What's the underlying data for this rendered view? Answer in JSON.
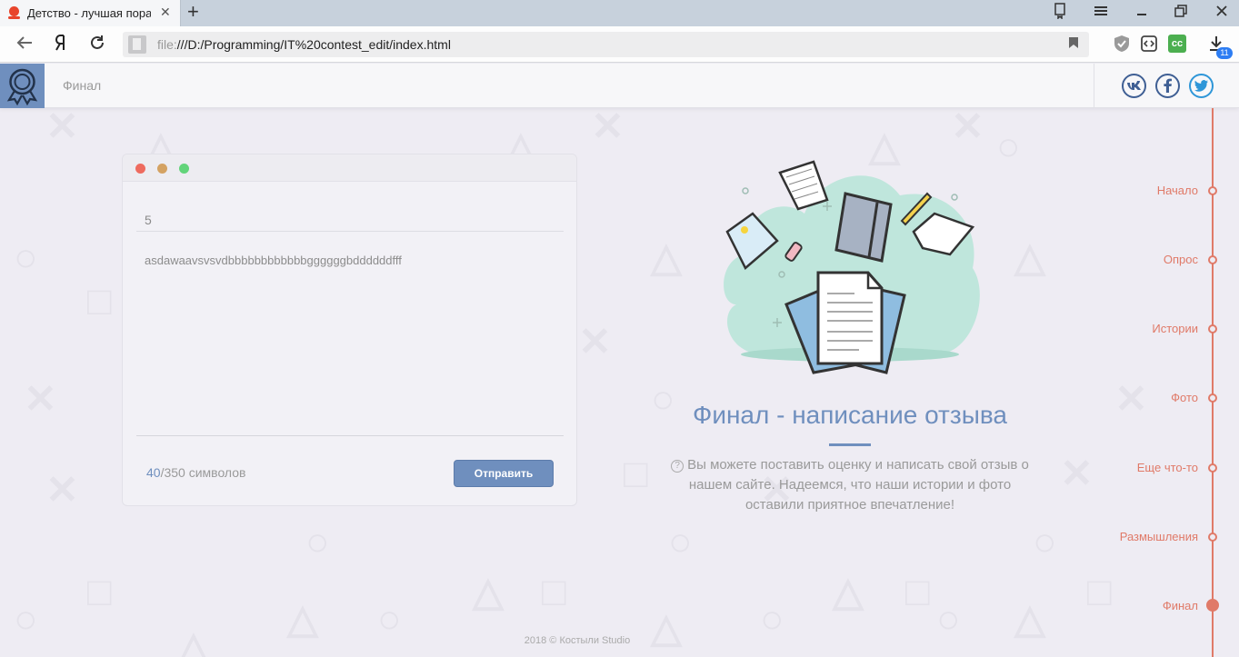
{
  "browser": {
    "tab_title": "Детство - лучшая пора",
    "tab_close": "✕",
    "new_tab": "+",
    "url_protocol": "file:",
    "url_path": "///D:/Programming/IT%20contest_edit/index.html",
    "downloads_count": "11"
  },
  "header": {
    "title": "Финал",
    "social": [
      {
        "name": "vk",
        "label": "vk"
      },
      {
        "name": "facebook",
        "label": "f"
      },
      {
        "name": "twitter",
        "label": "t"
      }
    ]
  },
  "form": {
    "rating_value": "5",
    "review_text": "asdawaavsvsvdbbbbbbbbbbbbggggggbddddddfff",
    "char_current": "40",
    "char_total": "/350 символов",
    "submit_label": "Отправить"
  },
  "info": {
    "title": "Финал - написание отзыва",
    "help_icon": "?",
    "description": "Вы можете поставить оценку и написать свой отзыв о нашем сайте. Надеемся, что наши истории и фото оставили приятное впечатление!"
  },
  "timeline": {
    "items": [
      "Начало",
      "Опрос",
      "Истории",
      "Фото",
      "Еще что-то",
      "Размышления",
      "Финал"
    ],
    "active": "Финал"
  },
  "footer": {
    "text": "2018 © Костыли Studio"
  },
  "colors": {
    "accent_blue": "#6f8fbe",
    "timeline_red": "#e07a68",
    "background": "#eeecf3"
  }
}
